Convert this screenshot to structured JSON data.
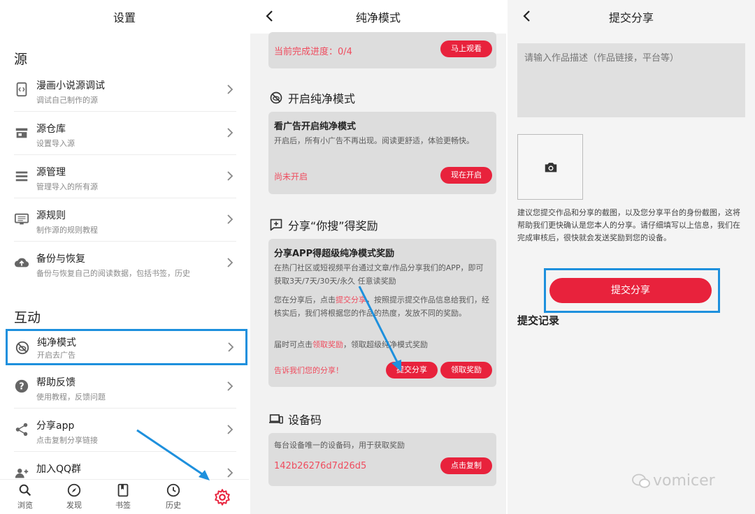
{
  "settings": {
    "title": "设置",
    "section_source": "源",
    "items": [
      {
        "label": "漫画小说源调试",
        "sub": "调试自己制作的源"
      },
      {
        "label": "源仓库",
        "sub": "设置导入源"
      },
      {
        "label": "源管理",
        "sub": "管理导入的所有源"
      },
      {
        "label": "源规则",
        "sub": "制作源的规则教程"
      },
      {
        "label": "备份与恢复",
        "sub": "备份与恢复自己的阅读数据，包括书签，历史"
      }
    ],
    "section_interact": "互动",
    "items2": [
      {
        "label": "纯净模式",
        "sub": "开启去广告"
      },
      {
        "label": "帮助反馈",
        "sub": "使用教程，反馈问题"
      },
      {
        "label": "分享app",
        "sub": "点击复制分享链接"
      },
      {
        "label": "加入QQ群",
        "sub": ""
      }
    ],
    "nav": [
      "浏览",
      "发现",
      "书签",
      "历史"
    ]
  },
  "pure": {
    "title": "纯净模式",
    "progress_text": "当前完成进度：0/4",
    "watch_btn": "马上观看",
    "sec_open": "开启纯净模式",
    "card1_title": "看广告开启纯净模式",
    "card1_body": "开启后，所有小广告不再出现。阅读更舒适，体验更畅快。",
    "card1_status": "尚未开启",
    "card1_btn": "现在开启",
    "sec_share": "分享“你搜”得奖励",
    "card2_title": "分享APP得超级纯净模式奖励",
    "card2_p1": "在热门社区或短视频平台通过文章/作品分享我们的APP，即可获取3天/7天/30天/永久 任意读奖励",
    "card2_p2a": "您在分享后，点击",
    "card2_p2_link": "提交分享",
    "card2_p2b": "，按照提示提交作品信息给我们，经核实后，我们将根据您的作品的热度，发放不同的奖励。",
    "card2_p3a": "届时可点击",
    "card2_p3_link": "领取奖励",
    "card2_p3b": "，领取超级纯净模式奖励",
    "card2_tell": "告诉我们您的分享！",
    "card2_btn_submit": "提交分享",
    "card2_btn_claim": "领取奖励",
    "sec_device": "设备码",
    "device_desc": "每台设备唯一的设备码，用于获取奖励",
    "device_code": "142b26276d7d26d5",
    "copy_btn": "点击复制"
  },
  "submit": {
    "title": "提交分享",
    "placeholder": "请输入作品描述（作品链接，平台等）",
    "note": "建议您提交作品和分享的截图，以及您分享平台的身份截图，这将帮助我们更快确认是您本人的分享。请仔细填写以上信息，我们在完成审核后，很快就会发送奖励到您的设备。",
    "button": "提交分享",
    "records": "提交记录",
    "watermark": "vomicer"
  },
  "colors": {
    "accent": "#e8223c",
    "highlight": "#1e90dd"
  }
}
